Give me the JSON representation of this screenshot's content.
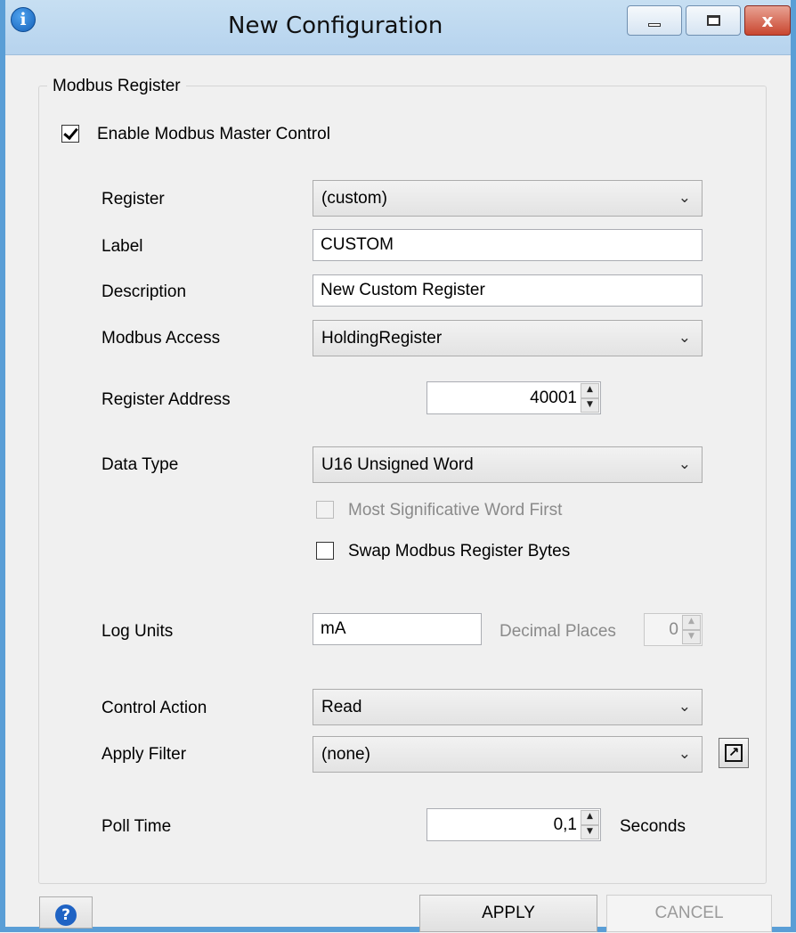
{
  "window": {
    "title": "New Configuration",
    "info_glyph": "i",
    "close_glyph": "x",
    "icons": [
      "info-icon",
      "minimize-icon",
      "maximize-icon",
      "close-icon"
    ]
  },
  "group": {
    "title": "Modbus Register"
  },
  "enable_master": {
    "label": "Enable Modbus Master Control",
    "checked": true
  },
  "fields": {
    "register": {
      "label": "Register",
      "value": "(custom)"
    },
    "label": {
      "label": "Label",
      "value": "CUSTOM"
    },
    "description": {
      "label": "Description",
      "value": "New Custom Register"
    },
    "modbus_access": {
      "label": "Modbus Access",
      "value": "HoldingRegister"
    },
    "register_address": {
      "label": "Register Address",
      "value": "40001"
    },
    "data_type": {
      "label": "Data Type",
      "value": "U16 Unsigned Word"
    },
    "msw_first": {
      "label": "Most Significative Word First",
      "checked": false,
      "enabled": false
    },
    "swap_bytes": {
      "label": "Swap Modbus Register Bytes",
      "checked": false
    },
    "log_units": {
      "label": "Log Units",
      "value": "mA"
    },
    "decimal_places": {
      "label": "Decimal Places",
      "value": "0",
      "enabled": false
    },
    "control_action": {
      "label": "Control Action",
      "value": "Read"
    },
    "apply_filter": {
      "label": "Apply Filter",
      "value": "(none)"
    },
    "poll_time": {
      "label": "Poll Time",
      "value": "0,1",
      "unit": "Seconds"
    }
  },
  "glyphs": {
    "chevron": "⌄",
    "spin_up": "▲",
    "spin_down": "▼",
    "popout": "↗",
    "help": "?"
  },
  "buttons": {
    "apply": "APPLY",
    "cancel": "CANCEL"
  },
  "colors": {
    "title_bar": "#b6d3ee",
    "close_button": "#c9462f",
    "help_icon": "#1f63c4"
  }
}
